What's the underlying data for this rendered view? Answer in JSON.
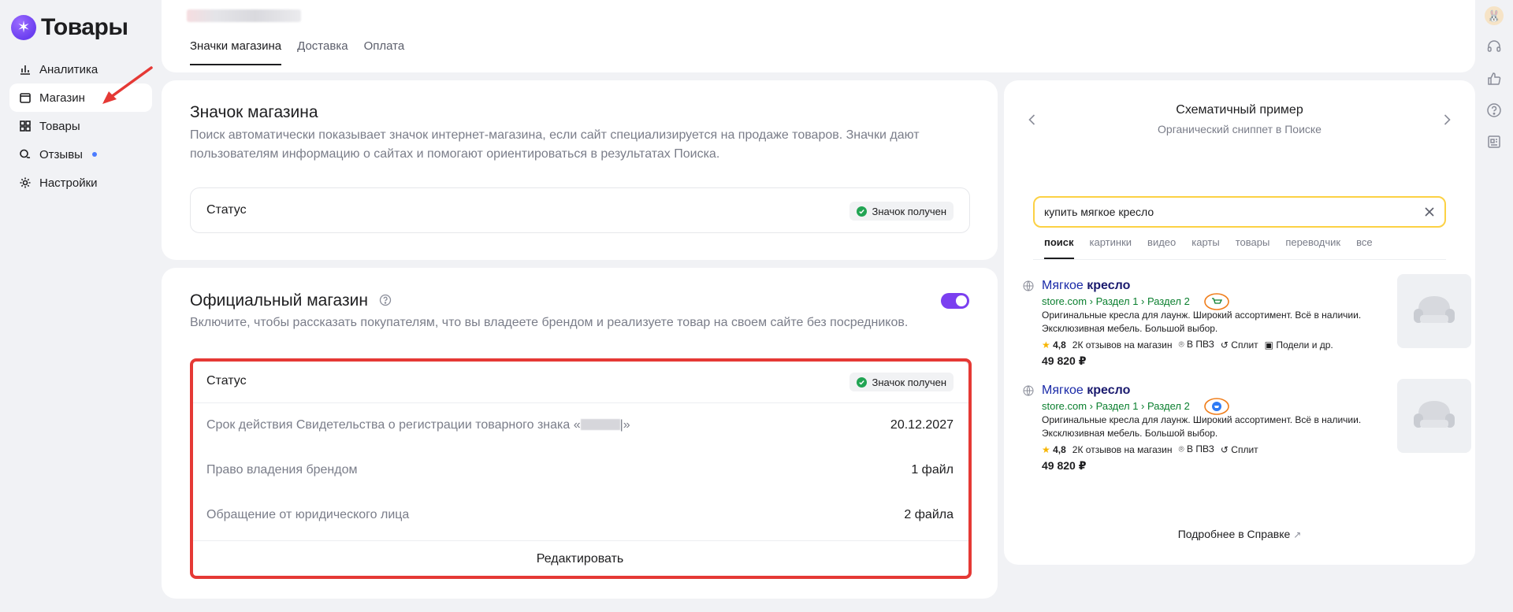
{
  "app": {
    "logo_text": "Товары"
  },
  "sidebar": {
    "items": [
      {
        "label": "Аналитика",
        "icon": "chart-icon"
      },
      {
        "label": "Магазин",
        "icon": "store-icon"
      },
      {
        "label": "Товары",
        "icon": "grid-icon"
      },
      {
        "label": "Отзывы",
        "icon": "chat-icon",
        "has_dot": true
      },
      {
        "label": "Настройки",
        "icon": "gear-icon"
      }
    ],
    "active_index": 1
  },
  "tabs": [
    {
      "label": "Значки магазина",
      "active": true
    },
    {
      "label": "Доставка",
      "active": false
    },
    {
      "label": "Оплата",
      "active": false
    }
  ],
  "store_badge": {
    "title": "Значок магазина",
    "description": "Поиск автоматически показывает значок интернет-магазина, если сайт специализируется на продаже товаров. Значки дают пользователям информацию о сайтах и помогают ориентироваться в результатах Поиска.",
    "status_label": "Статус",
    "status_value": "Значок получен"
  },
  "official_store": {
    "title": "Официальный магазин",
    "description": "Включите, чтобы рассказать покупателям, что вы владеете брендом и реализуете товар на своем сайте без посредников.",
    "toggle_on": true,
    "status_label": "Статус",
    "status_value": "Значок получен",
    "rows": [
      {
        "label_prefix": "Срок действия Свидетельства о регистрации товарного знака «",
        "label_suffix": "»",
        "value": "20.12.2027"
      },
      {
        "label": "Право владения брендом",
        "value": "1 файл"
      },
      {
        "label": "Обращение от юридического лица",
        "value": "2 файла"
      }
    ],
    "edit_label": "Редактировать"
  },
  "preview": {
    "title": "Схематичный пример",
    "subtitle": "Органический сниппет в Поиске",
    "search_query": "купить мягкое кресло",
    "serp_tabs": [
      "поиск",
      "картинки",
      "видео",
      "карты",
      "товары",
      "переводчик",
      "все"
    ],
    "snippets": [
      {
        "title_plain": "Мягкое ",
        "title_bold": "кресло",
        "url": "store.com › Раздел 1 › Раздел 2",
        "desc": "Оригинальные кресла для лаунж. Широкий ассортимент. Всё в наличии. Эксклюзивная мебель. Большой выбор.",
        "rating": "4,8",
        "reviews": "2К отзывов на магазин",
        "pickup": "В ПВЗ",
        "split": "Сплит",
        "extra": "Подели и др.",
        "price": "49 820 ₽",
        "badge_icon": "cart-icon"
      },
      {
        "title_plain": "Мягкое ",
        "title_bold": "кресло",
        "url": "store.com › Раздел 1 › Раздел 2",
        "desc": "Оригинальные кресла для лаунж. Широкий ассортимент. Всё в наличии. Эксклюзивная мебель. Большой выбор.",
        "rating": "4,8",
        "reviews": "2К отзывов на магазин",
        "pickup": "В ПВЗ",
        "split": "Сплит",
        "price": "49 820 ₽",
        "badge_icon": "verified-store-icon"
      }
    ],
    "footer_link": "Подробнее в Справке"
  },
  "colors": {
    "accent": "#7b3ff0",
    "status_green": "#21a453",
    "highlight_red": "#e53935",
    "search_border": "#fcd144"
  }
}
